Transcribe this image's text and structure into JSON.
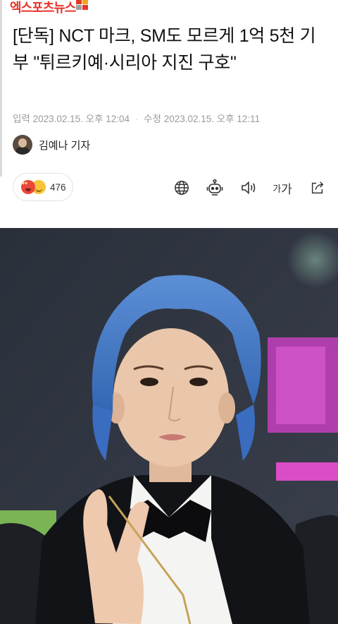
{
  "brand": {
    "name": "엑스포츠뉴스",
    "colors": {
      "text": "#e5352b",
      "mark": [
        "#e5352b",
        "#f6a21a",
        "#e5352b",
        "#9e9e9e"
      ]
    }
  },
  "article": {
    "title": "[단독] NCT 마크, SM도 모르게 1억 5천 기부 \"튀르키예·시리아 지진 구호\"",
    "published_label": "입력",
    "published": "2023.02.15. 오후 12:04",
    "separator": "·",
    "modified_label": "수정",
    "modified": "2023.02.15. 오후 12:11",
    "reporter": "김예나 기자"
  },
  "reactions": {
    "count": "476",
    "emojis": [
      "heart-eyes-emoji",
      "smile-emoji"
    ]
  },
  "toolbar": {
    "icons": [
      "globe-icon",
      "robot-icon",
      "speaker-icon",
      "font-size-icon",
      "share-icon"
    ],
    "font_size_small": "가",
    "font_size_large": "가"
  },
  "colors": {
    "meta_text": "#9a9a9a",
    "border": "#e3e3e3",
    "icon": "#333333"
  }
}
